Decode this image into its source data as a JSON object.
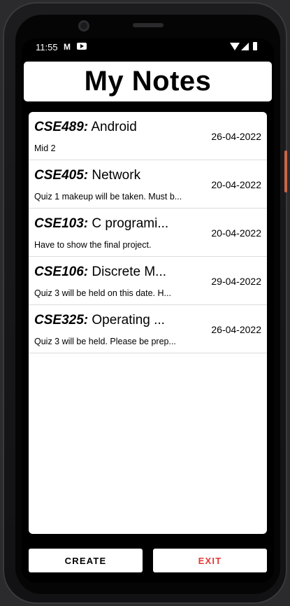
{
  "status_bar": {
    "time": "11:55",
    "gmail_glyph": "M",
    "icons": [
      "gmail-icon",
      "youtube-icon",
      "wifi-icon",
      "signal-icon",
      "battery-icon"
    ]
  },
  "header": {
    "title": "My Notes"
  },
  "notes": [
    {
      "code": "CSE489:",
      "title": " Android",
      "description": "Mid 2",
      "date": "26-04-2022"
    },
    {
      "code": "CSE405:",
      "title": " Network",
      "description": "Quiz 1 makeup will be taken. Must b...",
      "date": "20-04-2022"
    },
    {
      "code": "CSE103:",
      "title": " C programi...",
      "description": "Have to show the final project.",
      "date": "20-04-2022"
    },
    {
      "code": "CSE106:",
      "title": " Discrete M...",
      "description": "Quiz 3 will be held on this date. H...",
      "date": "29-04-2022"
    },
    {
      "code": "CSE325:",
      "title": " Operating ...",
      "description": "Quiz 3 will be held. Please be prep...",
      "date": "26-04-2022"
    }
  ],
  "actions": {
    "create_label": "CREATE",
    "exit_label": "EXIT"
  },
  "colors": {
    "background": "#000000",
    "card": "#ffffff",
    "exit_text": "#e53935"
  }
}
